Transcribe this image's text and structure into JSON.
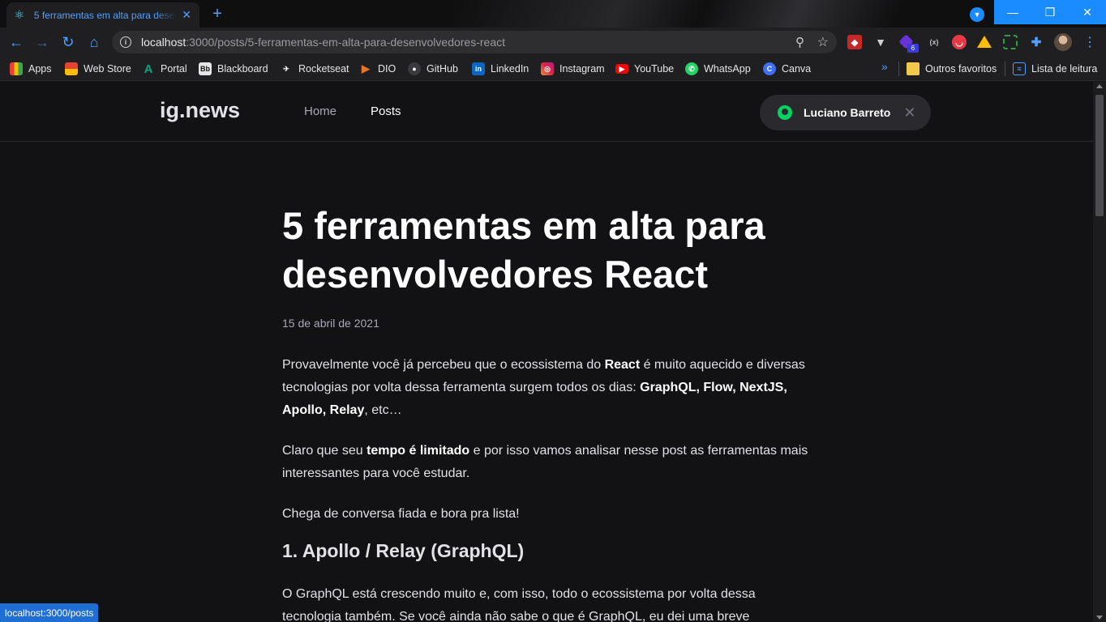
{
  "browser": {
    "tab": {
      "title": "5 ferramentas em alta para desenvolvedores React",
      "favicon": "react-icon"
    },
    "address": {
      "host": "localhost",
      "path": ":3000/posts/5-ferramentas-em-alta-para-desenvolvedores-react"
    },
    "extensions": [
      "extension-red-icon",
      "extension-v-icon",
      "extension-purple-icon",
      "extension-bracket-icon",
      "extension-pocket-icon",
      "google-drive-icon",
      "extension-green-icon",
      "puzzle-icon"
    ],
    "extension_badge": "6",
    "bookmarks": [
      {
        "label": "Apps",
        "icon": "apps-grid-icon",
        "color": "#e94235"
      },
      {
        "label": "Web Store",
        "icon": "web-store-icon",
        "color": "#fbbc04"
      },
      {
        "label": "Portal",
        "icon": "portal-icon",
        "color": "#0aa37f"
      },
      {
        "label": "Blackboard",
        "icon": "blackboard-icon",
        "color": "#333333"
      },
      {
        "label": "Rocketseat",
        "icon": "rocketseat-icon",
        "color": "#111111"
      },
      {
        "label": "DIO",
        "icon": "dio-icon",
        "color": "#e6742a"
      },
      {
        "label": "GitHub",
        "icon": "github-icon",
        "color": "#24292e"
      },
      {
        "label": "LinkedIn",
        "icon": "linkedin-icon",
        "color": "#0a66c2"
      },
      {
        "label": "Instagram",
        "icon": "instagram-icon",
        "color": "#d6249f"
      },
      {
        "label": "YouTube",
        "icon": "youtube-icon",
        "color": "#ff0000"
      },
      {
        "label": "WhatsApp",
        "icon": "whatsapp-icon",
        "color": "#25d366"
      },
      {
        "label": "Canva",
        "icon": "canva-icon",
        "color": "#3f6ef0"
      }
    ],
    "bookmarks_more": "»",
    "other_bookmarks": "Outros favoritos",
    "reading_list": "Lista de leitura",
    "status_url": "localhost:3000/posts"
  },
  "site": {
    "logo": "ig.news",
    "nav": [
      "Home",
      "Posts"
    ],
    "user_name": "Luciano Barreto",
    "accent": "#04d361"
  },
  "post": {
    "title": "5 ferramentas em alta para desenvolvedores React",
    "date": "15 de abril de 2021",
    "p1": {
      "a": "Provavelmente você já percebeu que o ecossistema do ",
      "b": "React",
      "c": " é muito aquecido e diversas tecnologias por volta dessa ferramenta surgem todos os dias: ",
      "d": "GraphQL, Flow, NextJS, Apollo, Relay",
      "e": ", etc…"
    },
    "p2": {
      "a": "Claro que seu ",
      "b": "tempo é limitado",
      "c": " e por isso vamos analisar nesse post as ferramentas mais interessantes para você estudar."
    },
    "p3": "Chega de conversa fiada e bora pra lista!",
    "h2": "1. Apollo / Relay (GraphQL)",
    "p4": "O GraphQL está crescendo muito e, com isso, todo o ecossistema por volta dessa tecnologia também. Se você ainda não sabe o que é GraphQL, eu dei uma breve"
  }
}
